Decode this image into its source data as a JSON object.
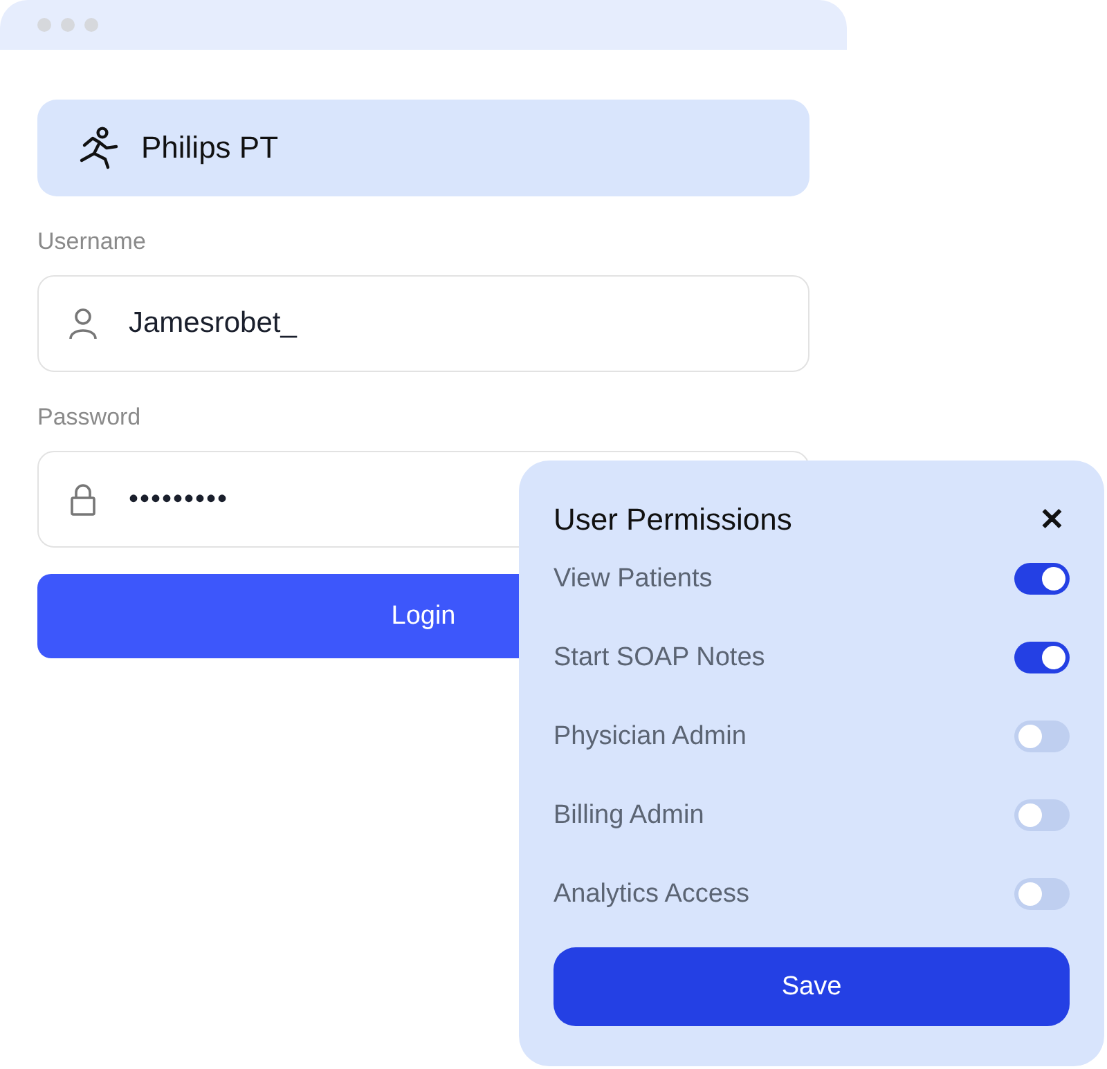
{
  "brand": {
    "name": "Philips PT"
  },
  "username": {
    "label": "Username",
    "value": "Jamesrobet_"
  },
  "password": {
    "label": "Password",
    "value": "•••••••••"
  },
  "login_button": "Login",
  "permissions": {
    "title": "User Permissions",
    "close": "✕",
    "items": [
      {
        "label": "View Patients",
        "on": true
      },
      {
        "label": "Start SOAP Notes",
        "on": true
      },
      {
        "label": "Physician Admin",
        "on": false
      },
      {
        "label": "Billing Admin",
        "on": false
      },
      {
        "label": "Analytics Access",
        "on": false
      }
    ],
    "save_button": "Save"
  }
}
